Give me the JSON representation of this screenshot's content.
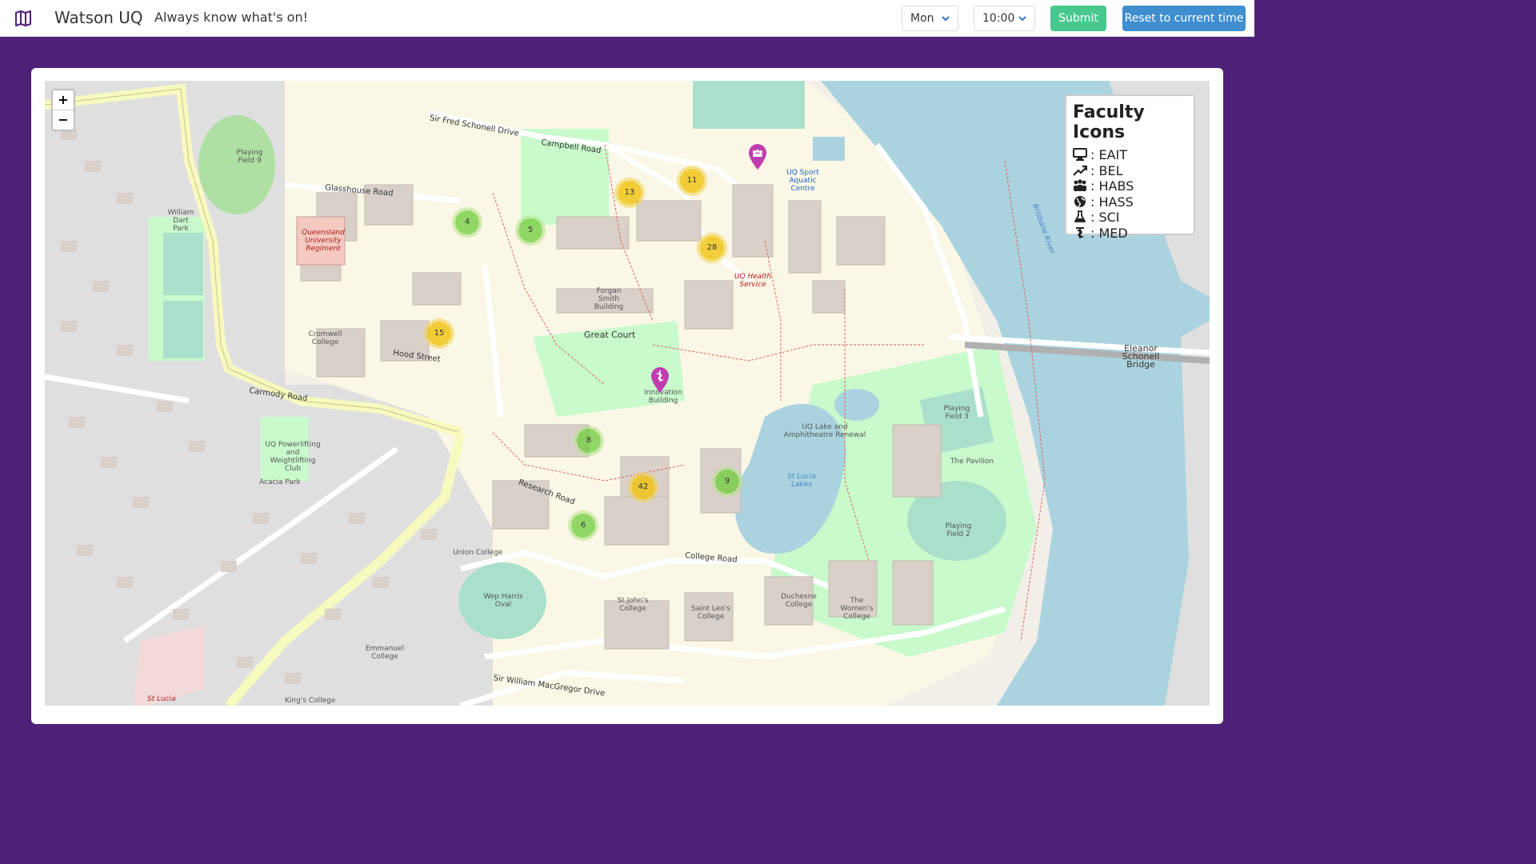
{
  "navbar": {
    "title": "Watson UQ",
    "subtitle": "Always know what's on!",
    "day_select": {
      "value": "Mon"
    },
    "time_select": {
      "value": "10:00"
    },
    "submit_label": "Submit",
    "reset_label": "Reset to current time"
  },
  "map": {
    "zoom_in": "+",
    "zoom_out": "−",
    "clusters": [
      {
        "count": "4",
        "color": "green"
      },
      {
        "count": "5",
        "color": "green"
      },
      {
        "count": "13",
        "color": "yellow"
      },
      {
        "count": "11",
        "color": "yellow"
      },
      {
        "count": "28",
        "color": "yellow"
      },
      {
        "count": "15",
        "color": "yellow"
      },
      {
        "count": "8",
        "color": "green"
      },
      {
        "count": "42",
        "color": "yellow"
      },
      {
        "count": "9",
        "color": "green"
      },
      {
        "count": "6",
        "color": "green"
      }
    ],
    "labels": {
      "glasshouse": "Glasshouse Road",
      "fred_schonell": "Sir Fred Schonell Drive",
      "campbell": "Campbell Road",
      "carmody": "Carmody Road",
      "hood": "Hood Street",
      "college": "College Road",
      "macgregor": "Sir William MacGregor Drive",
      "research": "Research Road",
      "great_court": "Great Court",
      "playing_field_9": "Playing Field 9",
      "playing_field_3": "Playing Field 3",
      "playing_field_2": "Playing Field 2",
      "wep_harris": "Wep Harris Oval",
      "uq_lake": "UQ Lake and Amphitheatre Renewal",
      "st_lucia_lakes": "St Lucia Lakes",
      "eleanor_bridge": "Eleanor Schonell Bridge",
      "union_college": "Union College",
      "emmanuel": "Emmanuel College",
      "st_johns": "St John's College",
      "saint_leos": "Saint Leo's College",
      "duchesne": "Duchesne College",
      "womens": "The Women's College",
      "cromwell": "Cromwell College",
      "forgan": "Forgan Smith Building",
      "uq_health": "UQ Health Service",
      "uq_sport": "UQ Sport Aquatic Centre",
      "innovation": "Innovation Building",
      "the_pavilion": "The Pavilion",
      "st_lucia": "St Lucia",
      "brisbane_river": "Brisbane River",
      "queensland_regiment": "Queensland University Regiment",
      "kings_college": "King's College",
      "william_dart": "William Dart Park",
      "acacia_park": "Acacia Park",
      "uq_powerlifting": "UQ Powerlifting and Weightlifting Club",
      "eleanor_label": "Eleanor Schonell Bridge"
    }
  },
  "legend": {
    "title": "Faculty Icons",
    "items": [
      {
        "icon": "monitor-icon",
        "label": ": EAIT"
      },
      {
        "icon": "trend-up-icon",
        "label": ": BEL"
      },
      {
        "icon": "people-icon",
        "label": ": HABS"
      },
      {
        "icon": "globe-icon",
        "label": ": HASS"
      },
      {
        "icon": "flask-icon",
        "label": ": SCI"
      },
      {
        "icon": "medical-icon",
        "label": ": MED"
      }
    ]
  },
  "colors": {
    "header_bg": "#4e2179",
    "submit": "#48c78e",
    "reset": "#3e8ed0",
    "water": "#aad3df",
    "park": "#c8facc",
    "pin": "#c03db0"
  }
}
